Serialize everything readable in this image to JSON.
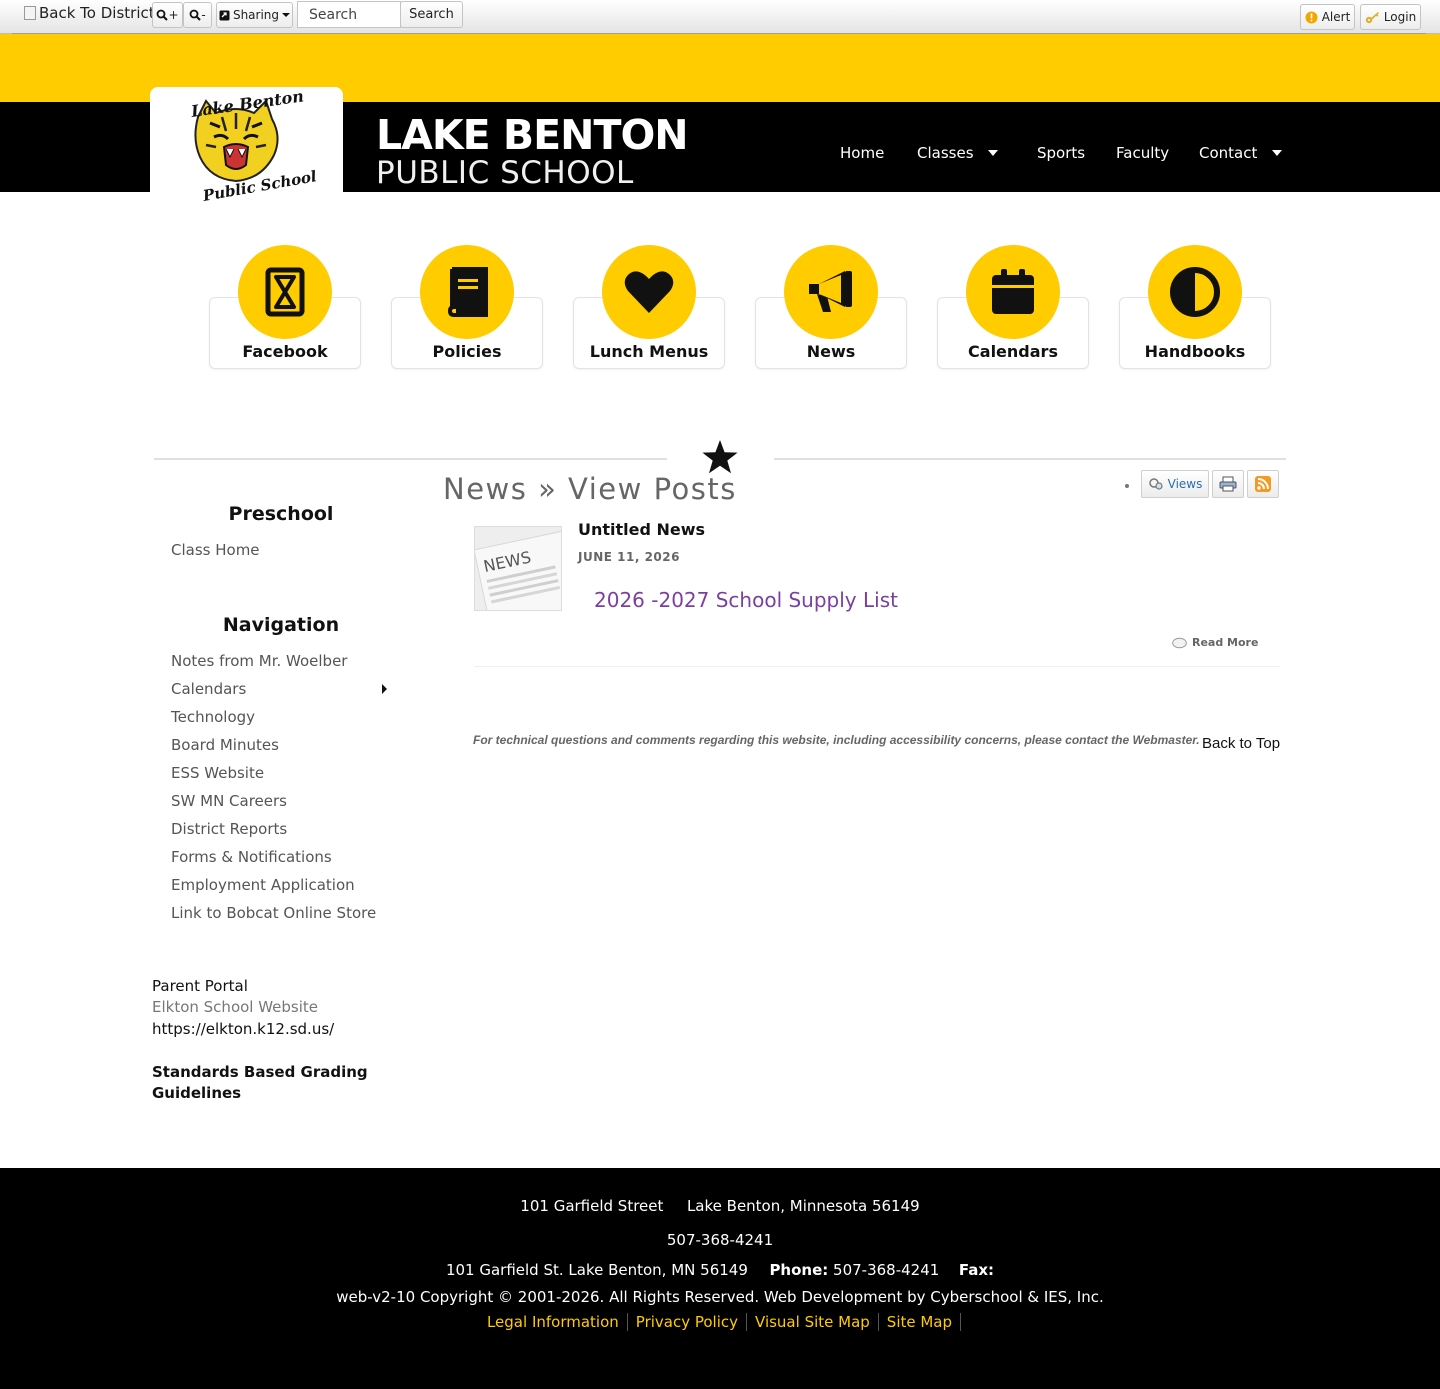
{
  "toolbar": {
    "back_to_district": "Back To District",
    "zoom_in_label": "+",
    "zoom_out_label": "-",
    "sharing_label": "Sharing",
    "search_placeholder": "Search",
    "search_button": "Search",
    "alert_label": "Alert",
    "login_label": "Login"
  },
  "header": {
    "logo_line1": "Lake Benton",
    "logo_line2": "Public School",
    "school_name_line1": "LAKE BENTON",
    "school_name_line2": "PUBLIC SCHOOL",
    "nav": {
      "home": "Home",
      "classes": "Classes",
      "sports": "Sports",
      "faculty": "Faculty",
      "contact": "Contact"
    }
  },
  "quick_links": [
    {
      "label": "Facebook",
      "icon": "hourglass-icon"
    },
    {
      "label": "Policies",
      "icon": "book-icon"
    },
    {
      "label": "Lunch Menus",
      "icon": "heart-icon"
    },
    {
      "label": "News",
      "icon": "megaphone-icon"
    },
    {
      "label": "Calendars",
      "icon": "calendar-icon"
    },
    {
      "label": "Handbooks",
      "icon": "half-circle-icon"
    }
  ],
  "page": {
    "title": "News » View Posts",
    "views_label": "Views"
  },
  "sidebar": {
    "preschool_heading": "Preschool",
    "preschool_links": [
      "Class Home"
    ],
    "navigation_heading": "Navigation",
    "navigation_links": [
      "Notes from Mr. Woelber",
      "Calendars",
      "Technology",
      "Board Minutes",
      "ESS Website",
      "SW MN Careers",
      "District Reports",
      "Forms & Notifications",
      "Employment Application",
      "Link to Bobcat Online Store"
    ],
    "parent_portal": "Parent Portal",
    "elkton_link": "Elkton School Website",
    "elkton_url": "https://elkton.k12.sd.us/",
    "grading_line1": "Standards Based Grading",
    "grading_line2": "Guidelines"
  },
  "post": {
    "thumb_label": "NEWS",
    "title": "Untitled News",
    "date": "JUNE 11, 2026",
    "link_text": "2026 -2027 School Supply List",
    "read_more": "Read More"
  },
  "content_footer": {
    "tech_note": "For technical questions and comments regarding this website, including accessibility concerns, please contact the Webmaster.",
    "back_to_top": "Back to Top"
  },
  "footer": {
    "address_street": "101 Garfield Street",
    "address_city": "Lake Benton, Minnesota 56149",
    "phone": "507-368-4241",
    "address_short": "101 Garfield St. Lake Benton, MN 56149",
    "phone_label": "Phone:",
    "phone_value": "507-368-4241",
    "fax_label": "Fax:",
    "copyright": "web-v2-10 Copyright © 2001-2026. All Rights Reserved. Web Development by Cyberschool & IES, Inc.",
    "links": [
      "Legal Information",
      "Privacy Policy",
      "Visual Site Map",
      "Site Map"
    ]
  },
  "colors": {
    "brand_yellow": "#ffcc00",
    "header_black": "#000000",
    "post_link": "#7b3fa0"
  }
}
